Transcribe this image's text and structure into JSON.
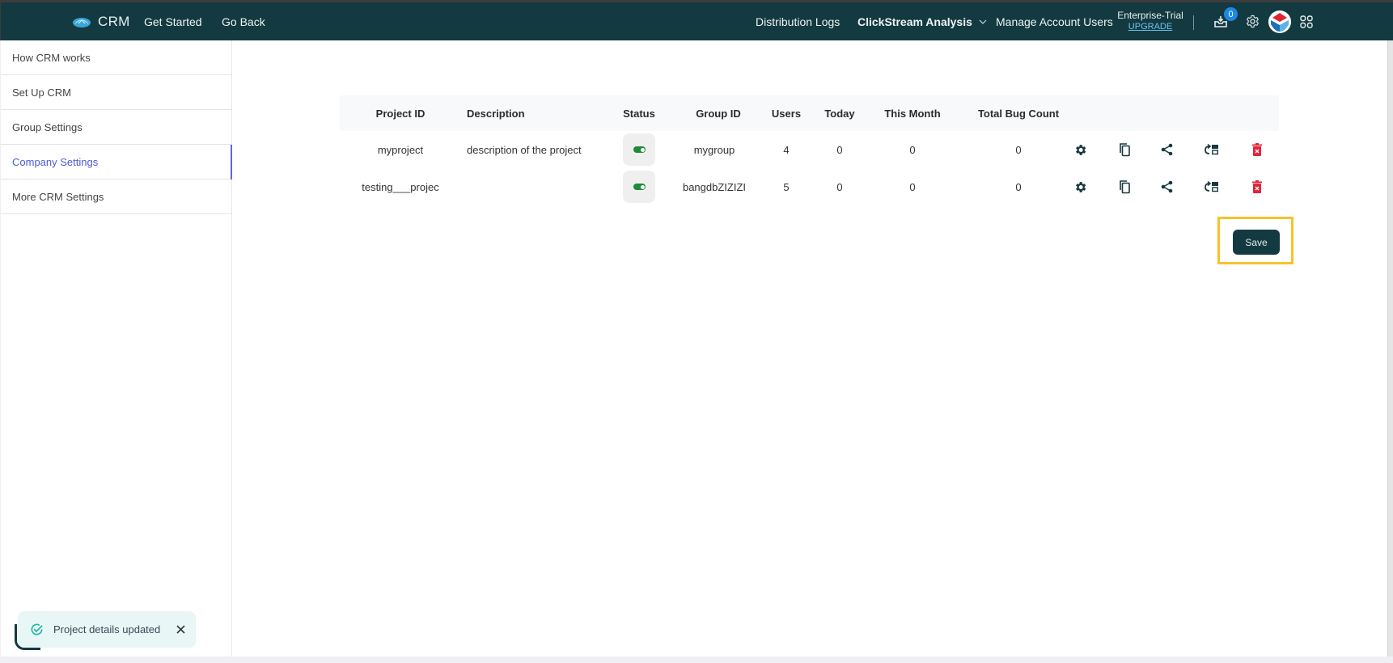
{
  "topbar": {
    "brand": "CRM",
    "nav_left": [
      "Get Started",
      "Go Back"
    ],
    "nav_right": {
      "distribution_logs": "Distribution Logs",
      "clickstream": "ClickStream Analysis",
      "manage_users": "Manage Account Users"
    },
    "plan": {
      "name": "Enterprise-Trial",
      "upgrade": "UPGRADE"
    },
    "notifications_count": "0",
    "icons": [
      "inbox-icon",
      "gear-icon",
      "avatar",
      "apps-grid-icon"
    ]
  },
  "sidebar": {
    "items": [
      {
        "label": "How CRM works",
        "active": false
      },
      {
        "label": "Set Up CRM",
        "active": false
      },
      {
        "label": "Group Settings",
        "active": false
      },
      {
        "label": "Company Settings",
        "active": true
      },
      {
        "label": "More CRM Settings",
        "active": false
      }
    ]
  },
  "table": {
    "columns": [
      "Project ID",
      "Description",
      "Status",
      "Group ID",
      "Users",
      "Today",
      "This Month",
      "Total Bug Count"
    ],
    "rows": [
      {
        "project_id": "myproject",
        "description": "description of the project",
        "status": "on",
        "group_id": "mygroup",
        "users": "4",
        "today": "0",
        "this_month": "0",
        "total_bug_count": "0"
      },
      {
        "project_id": "testing___projec",
        "description": "",
        "status": "on",
        "group_id": "bangdbZIZIZI",
        "users": "5",
        "today": "0",
        "this_month": "0",
        "total_bug_count": "0"
      }
    ],
    "row_actions": [
      "settings-icon",
      "copy-icon",
      "share-icon",
      "sync-icon",
      "delete-icon"
    ]
  },
  "save_label": "Save",
  "toast": {
    "message": "Project details updated"
  },
  "colors": {
    "primary": "#133a40",
    "accent": "#5c67e0",
    "toggle_on": "#1e8a3a",
    "delete": "#e0253a",
    "highlight": "#f8c22c",
    "badge": "#1e88e5"
  }
}
